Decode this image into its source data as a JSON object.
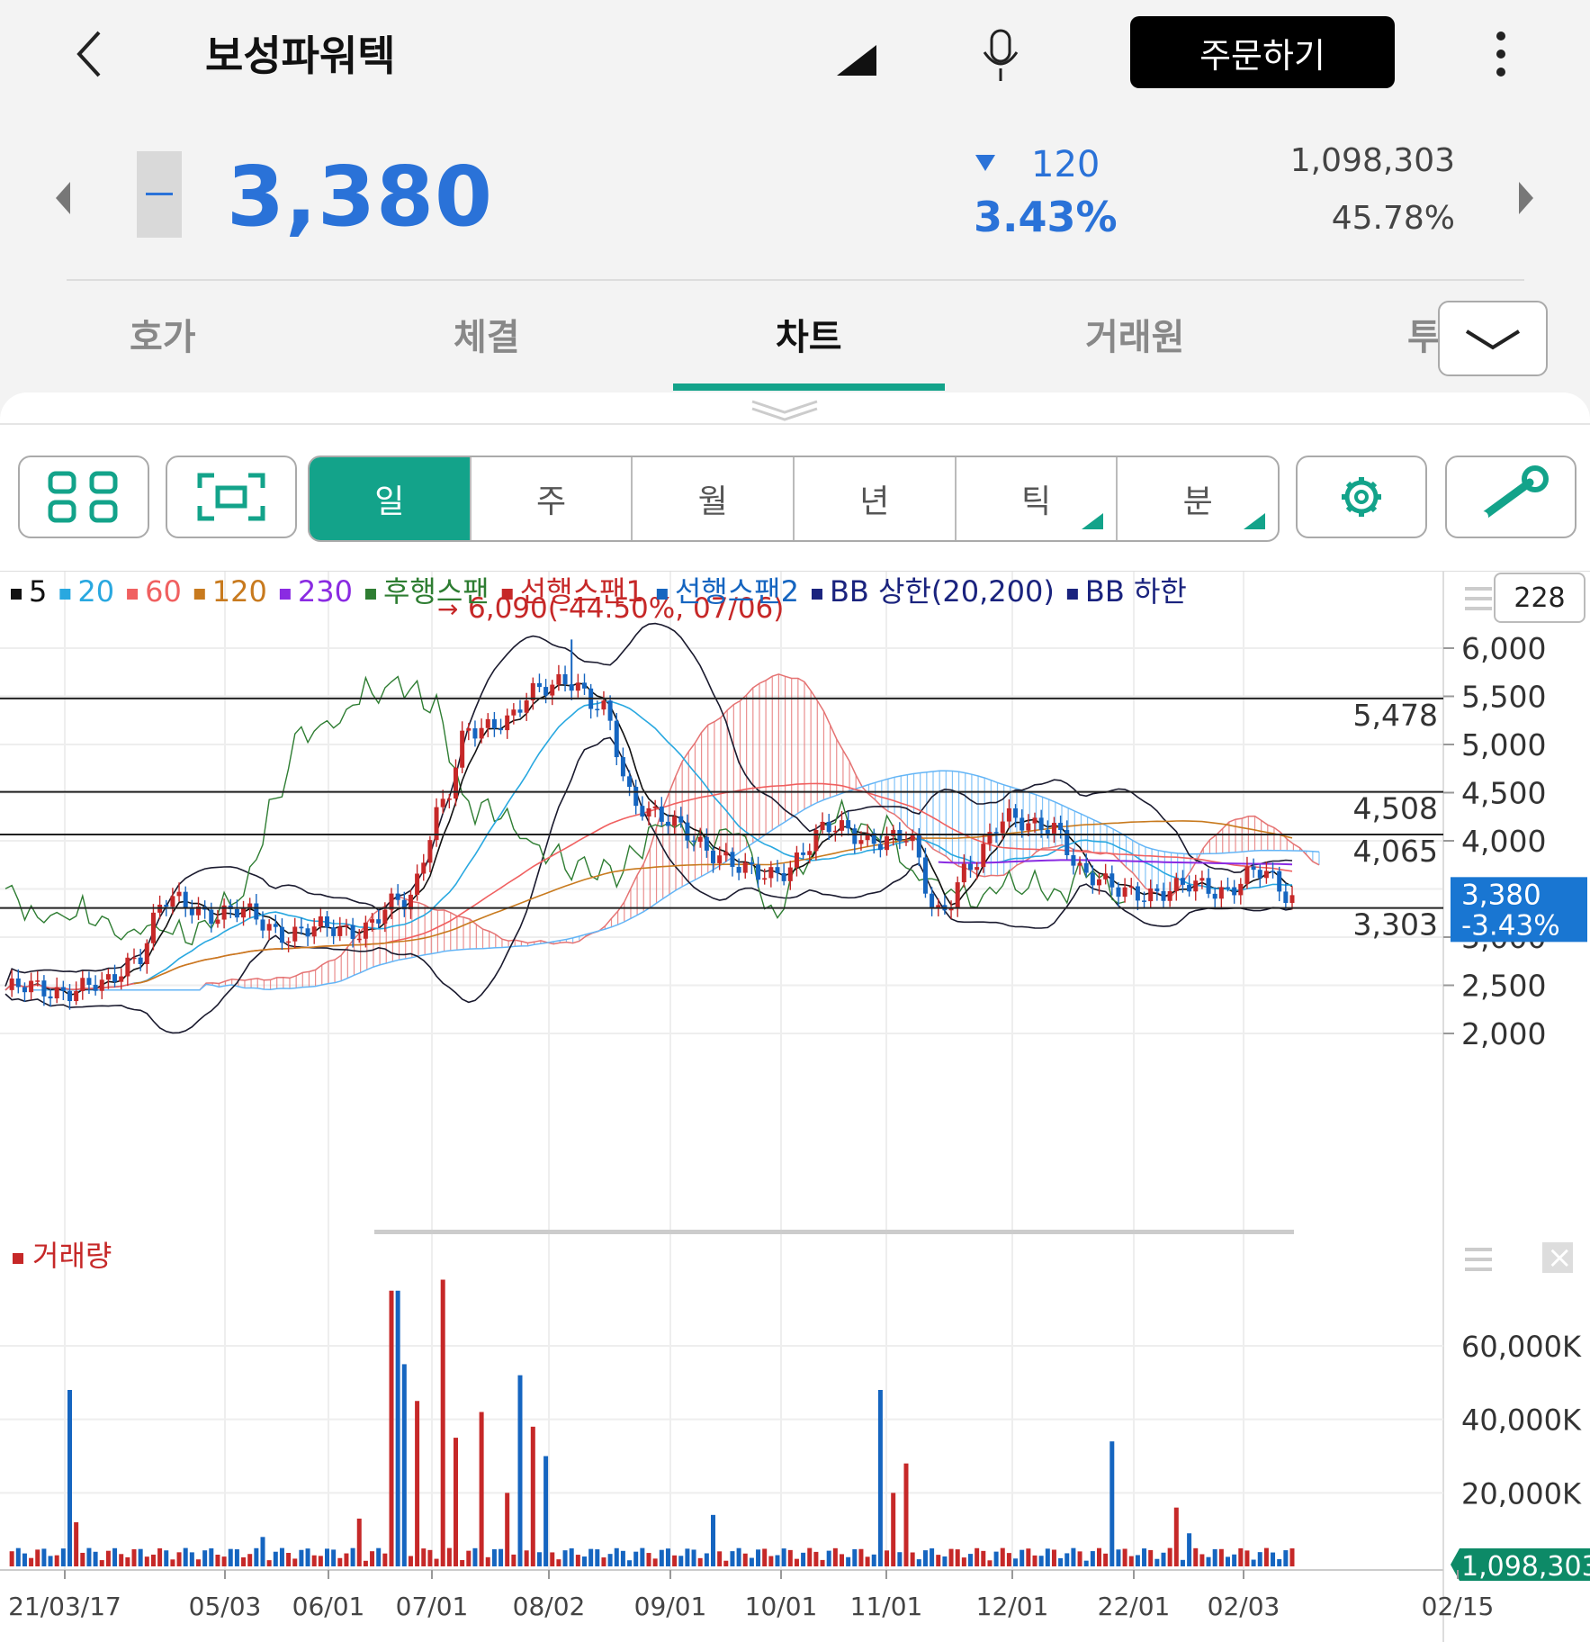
{
  "header": {
    "title": "보성파워텍",
    "order_button": "주문하기"
  },
  "quote": {
    "price": "3,380",
    "change": "120",
    "change_pct": "3.43%",
    "volume": "1,098,303",
    "turnover_rate": "45.78%"
  },
  "tabs": [
    "호가",
    "체결",
    "차트",
    "거래원",
    "투"
  ],
  "active_tab": "차트",
  "periods": [
    {
      "label": "일",
      "active": true,
      "corner": false
    },
    {
      "label": "주",
      "active": false,
      "corner": false
    },
    {
      "label": "월",
      "active": false,
      "corner": false
    },
    {
      "label": "년",
      "active": false,
      "corner": false
    },
    {
      "label": "틱",
      "active": false,
      "corner": true
    },
    {
      "label": "분",
      "active": false,
      "corner": true
    }
  ],
  "legend": [
    {
      "label": "5",
      "color": "#111111"
    },
    {
      "label": "20",
      "color": "#29a8e0"
    },
    {
      "label": "60",
      "color": "#f06060"
    },
    {
      "label": "120",
      "color": "#c87a1e"
    },
    {
      "label": "230",
      "color": "#8a2be2"
    },
    {
      "label": "후행스팬",
      "color": "#2e7d32"
    },
    {
      "label": "선행스팬1",
      "color": "#c62828"
    },
    {
      "label": "선행스팬2",
      "color": "#1565c0"
    },
    {
      "label": "BB 상한(20,200)",
      "color": "#1a237e"
    },
    {
      "label": "BB 하한",
      "color": "#1a237e"
    }
  ],
  "candle_count": "228",
  "max_marker": "6,090(-44.50%, 07/06)",
  "price_axis": [
    "6,000",
    "5,500",
    "5,000",
    "4,500",
    "4,000",
    "3,000",
    "2,500",
    "2,000"
  ],
  "horizontal_levels": [
    "5,478",
    "4,508",
    "4,065",
    "3,303"
  ],
  "current_price_tag": {
    "price": "3,380",
    "pct": "-3.43%"
  },
  "volume_legend": "거래량",
  "volume_axis": [
    "60,000K",
    "40,000K",
    "20,000K"
  ],
  "volume_tag": "1,098,303",
  "date_axis": [
    "21/03/17",
    "05/03",
    "06/01",
    "07/01",
    "08/02",
    "09/01",
    "10/01",
    "11/01",
    "12/01",
    "22/01",
    "02/03",
    "02/15"
  ],
  "colors": {
    "accent": "#13a38a",
    "down": "#2a72d8",
    "up": "#c62828"
  },
  "chart_data": {
    "type": "candlestick",
    "series": [
      {
        "name": "5",
        "values": [
          2400,
          2600,
          3000,
          3400,
          3300,
          3100,
          3150,
          3200,
          3350,
          3900,
          4200,
          5200,
          5500,
          5000,
          4600,
          4100,
          3700,
          3900,
          4200,
          3950,
          4100,
          3500,
          4300,
          4000,
          3700,
          3500,
          3400,
          3500,
          3600,
          3900,
          4000,
          3380
        ]
      },
      {
        "name": "20",
        "values": [
          2300,
          2500,
          2800,
          3100,
          3200,
          3150,
          3200,
          3300,
          3500,
          3800,
          4100,
          4700,
          5000,
          4800,
          4500,
          4300,
          3900,
          3900,
          4000,
          3950,
          4000,
          3800,
          4200,
          4100,
          3800,
          3600,
          3500,
          3500,
          3600,
          3700,
          3850,
          3700
        ]
      }
    ],
    "ylim": [
      1800,
      6200
    ],
    "volume_ylim": [
      0,
      80000
    ]
  }
}
